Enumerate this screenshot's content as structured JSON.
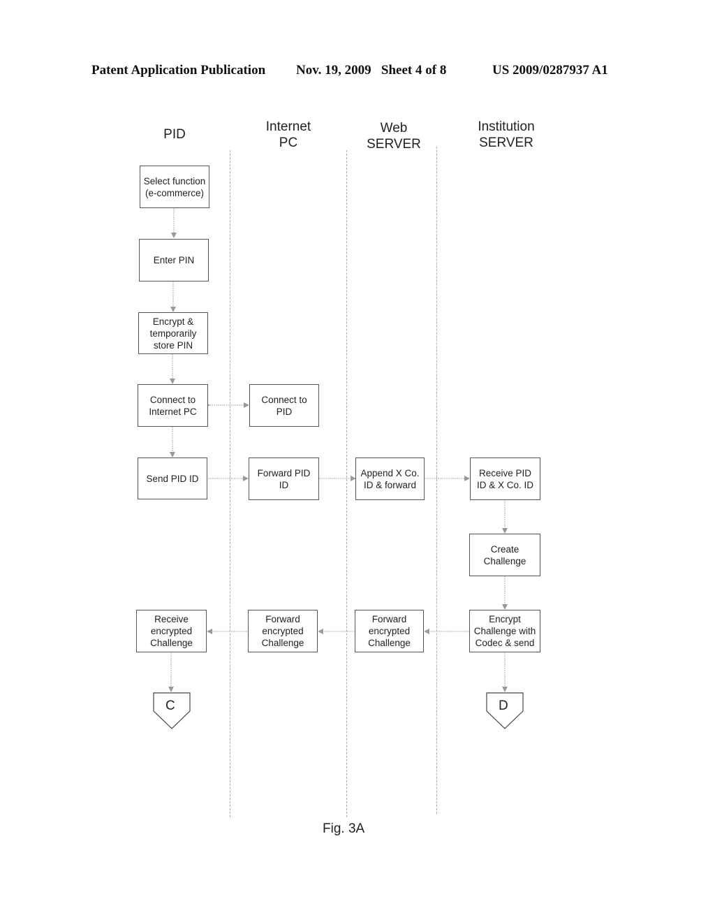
{
  "header": {
    "left": "Patent Application Publication",
    "center": "Nov. 19, 2009   Sheet 4 of 8",
    "right": "US 2009/0287937 A1"
  },
  "lanes": [
    {
      "title": "PID"
    },
    {
      "title": "Internet\nPC"
    },
    {
      "title": "Web\nSERVER"
    },
    {
      "title": "Institution\nSERVER"
    }
  ],
  "boxes": {
    "select_function": "Select function\n(e-commerce)",
    "enter_pin": "Enter PIN",
    "encrypt_store_pin": "Encrypt &\ntemporarily\nstore PIN",
    "connect_internet_pc": "Connect to\nInternet PC",
    "connect_pid": "Connect to\nPID",
    "send_pid_id": "Send PID ID",
    "forward_pid_id": "Forward PID\nID",
    "append_xco_id": "Append X Co.\nID & forward",
    "receive_pid_id": "Receive PID\nID & X Co. ID",
    "create_challenge": "Create\nChallenge",
    "encrypt_challenge": "Encrypt\nChallenge with\nCodec & send",
    "forward_challenge_web": "Forward\nencrypted\nChallenge",
    "forward_challenge_pc": "Forward\nencrypted\nChallenge",
    "receive_challenge": "Receive\nencrypted\nChallenge"
  },
  "connectors": {
    "c": "C",
    "d": "D"
  },
  "caption": "Fig. 3A"
}
